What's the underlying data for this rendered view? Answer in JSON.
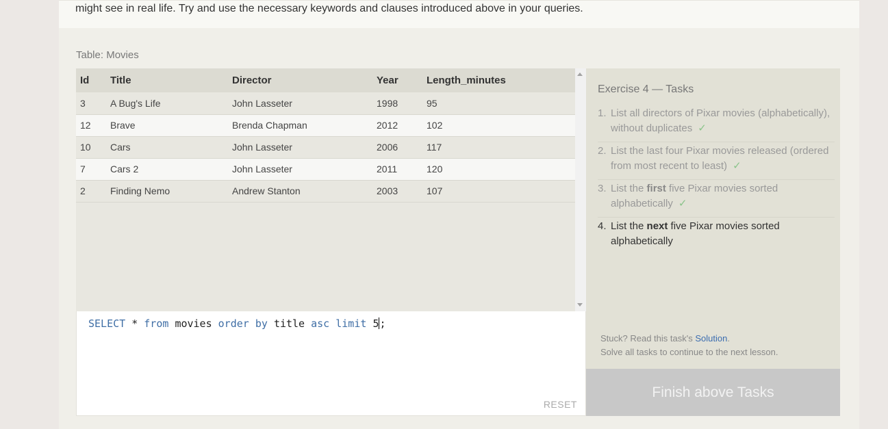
{
  "intro": {
    "text": "might see in real life. Try and use the necessary keywords and clauses introduced above in your queries."
  },
  "table": {
    "label": "Table: Movies",
    "columns": [
      "Id",
      "Title",
      "Director",
      "Year",
      "Length_minutes"
    ],
    "rows": [
      [
        "3",
        "A Bug's Life",
        "John Lasseter",
        "1998",
        "95"
      ],
      [
        "12",
        "Brave",
        "Brenda Chapman",
        "2012",
        "102"
      ],
      [
        "10",
        "Cars",
        "John Lasseter",
        "2006",
        "117"
      ],
      [
        "7",
        "Cars 2",
        "John Lasseter",
        "2011",
        "120"
      ],
      [
        "2",
        "Finding Nemo",
        "Andrew Stanton",
        "2003",
        "107"
      ]
    ]
  },
  "editor": {
    "tokens": [
      "SELECT",
      "*",
      "from",
      "movies",
      "order by",
      "title",
      "asc",
      "limit",
      "5",
      ";"
    ],
    "reset_label": "RESET"
  },
  "tasks": {
    "title": "Exercise 4 — Tasks",
    "items": [
      {
        "num": "1.",
        "before": "List all directors of Pixar movies (alphabetically), without duplicates",
        "bold": "",
        "after": "",
        "done": true
      },
      {
        "num": "2.",
        "before": "List the last four Pixar movies released (ordered from most recent to least)",
        "bold": "",
        "after": "",
        "done": true
      },
      {
        "num": "3.",
        "before": "List the ",
        "bold": "first",
        "after": " five Pixar movies sorted alphabetically",
        "done": true
      },
      {
        "num": "4.",
        "before": "List the ",
        "bold": "next",
        "after": " five Pixar movies sorted alphabetically",
        "done": false
      }
    ],
    "check_mark": "✓",
    "stuck_prefix": "Stuck? Read this task's ",
    "solution_label": "Solution",
    "stuck_suffix": ".",
    "continue_text": "Solve all tasks to continue to the next lesson."
  },
  "finish_button": {
    "label": "Finish above Tasks"
  }
}
